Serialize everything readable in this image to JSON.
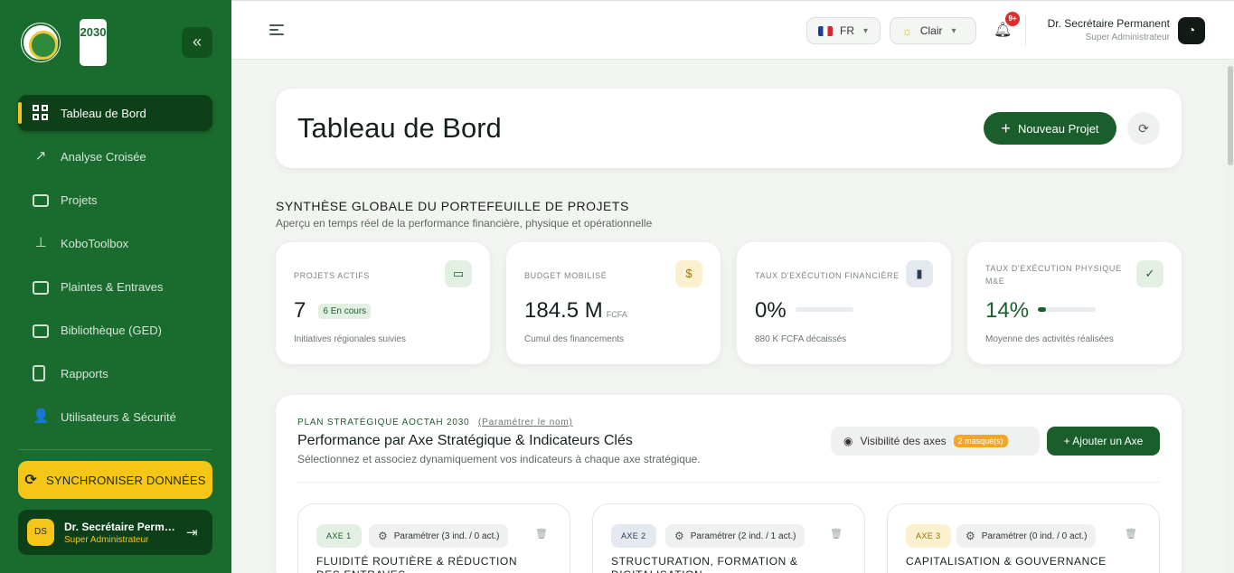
{
  "sidebar": {
    "logo2_text": "2030",
    "items": [
      {
        "label": "Tableau de Bord",
        "icon": "dashboard-grid-icon",
        "active": true
      },
      {
        "label": "Analyse Croisée",
        "icon": "trending-up-icon"
      },
      {
        "label": "Projets",
        "icon": "briefcase-icon"
      },
      {
        "label": "KoboToolbox",
        "icon": "kobo-icon"
      },
      {
        "label": "Plaintes & Entraves",
        "icon": "map-icon"
      },
      {
        "label": "Bibliothèque (GED)",
        "icon": "book-icon"
      },
      {
        "label": "Rapports",
        "icon": "report-icon"
      },
      {
        "label": "Utilisateurs & Sécurité",
        "icon": "users-icon"
      }
    ],
    "sync_label": "SYNCHRONISER DONNÉES",
    "user": {
      "initials": "DS",
      "name": "Dr. Secrétaire Permanent",
      "role": "Super Administrateur"
    }
  },
  "topbar": {
    "language": "FR",
    "theme": "Clair",
    "notifications": "9+",
    "user_name": "Dr. Secrétaire Permanent",
    "user_role": "Super Administrateur"
  },
  "header": {
    "title": "Tableau de Bord",
    "new_project_label": "Nouveau Projet"
  },
  "synthese": {
    "title": "SYNTHÈSE GLOBALE DU PORTEFEUILLE DE PROJETS",
    "subtitle": "Aperçu en temps réel de la performance financière, physique et opérationnelle"
  },
  "kpis": [
    {
      "label": "PROJETS ACTIFS",
      "value": "7",
      "badge": "6 En cours",
      "note": "Initiatives régionales suivies",
      "icon": "briefcase-icon"
    },
    {
      "label": "BUDGET MOBILISÉ",
      "value": "184.5 M",
      "unit": "FCFA",
      "note": "Cumul des financements",
      "icon": "dollar-icon"
    },
    {
      "label": "TAUX D'EXÉCUTION FINANCIÈRE",
      "value": "0%",
      "progress": 0,
      "note": "880 K FCFA décaissés",
      "icon": "bar-chart-icon"
    },
    {
      "label": "TAUX D'EXÉCUTION PHYSIQUE M&E",
      "value": "14%",
      "progress": 14,
      "note": "Moyenne des activités réalisées",
      "icon": "check-circle-icon"
    }
  ],
  "axes_section": {
    "plan_label": "PLAN STRATÉGIQUE AOCTAH 2030",
    "plan_link": "(Paramétrer le nom)",
    "title": "Performance par Axe Stratégique & Indicateurs Clés",
    "subtitle": "Sélectionnez et associez dynamiquement vos indicateurs à chaque axe stratégique.",
    "visibility_label": "Visibilité des axes",
    "visibility_badge": "2 masqué(s)",
    "add_axis_label": "+ Ajouter un Axe",
    "axes": [
      {
        "tag": "AXE 1",
        "param": "Paramétrer (3 ind. / 0 act.)",
        "title": "FLUIDITÉ ROUTIÈRE & RÉDUCTION DES ENTRAVES",
        "tag_color": "#e3efe3",
        "tag_text_color": "#1a5e2c"
      },
      {
        "tag": "AXE 2",
        "param": "Paramétrer (2 ind. / 1 act.)",
        "title": "STRUCTURATION, FORMATION & DIGITALISATION",
        "tag_color": "#e4e9ef",
        "tag_text_color": "#2c3e55"
      },
      {
        "tag": "AXE 3",
        "param": "Paramétrer (0 ind. / 0 act.)",
        "title": "CAPITALISATION & GOUVERNANCE",
        "tag_color": "#fbf0cf",
        "tag_text_color": "#9a7300"
      }
    ]
  },
  "colors": {
    "primary": "#1a6b2e",
    "accent": "#f5c518",
    "dark": "#0d3f18"
  }
}
